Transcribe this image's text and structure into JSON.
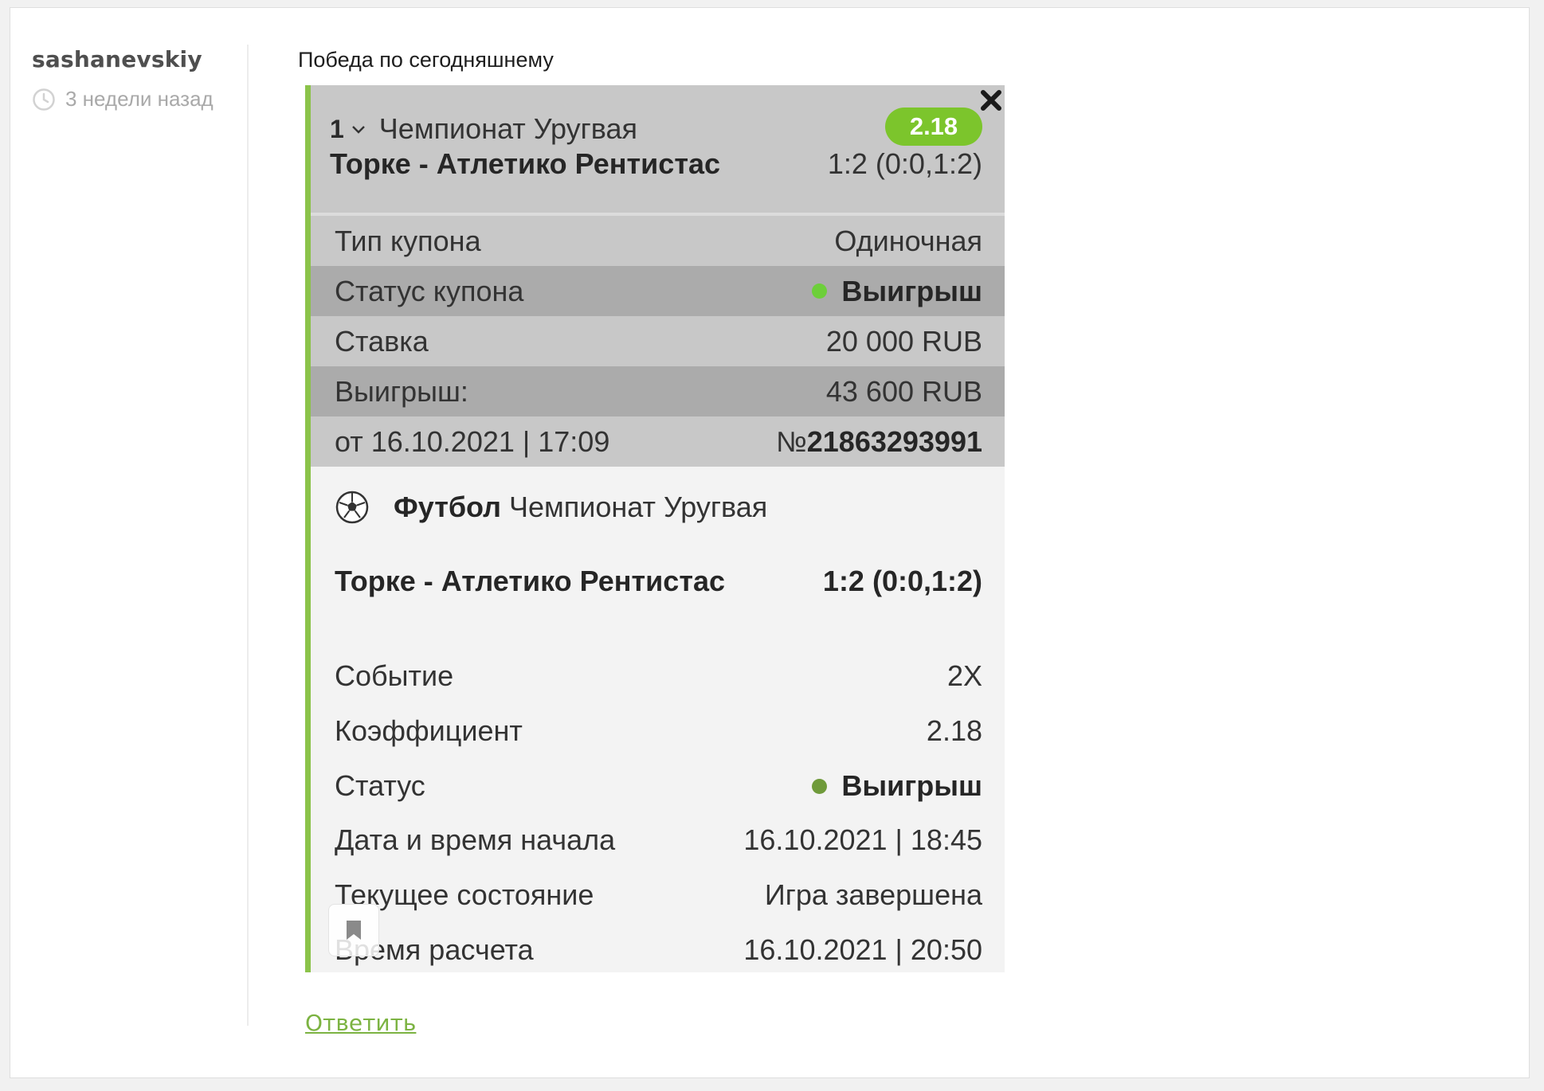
{
  "comment": {
    "author": "sashanevskiy",
    "time": "3 недели назад",
    "text": "Победа по сегодняшнему",
    "reply_label": "Ответить"
  },
  "coupon": {
    "header": {
      "index": "1",
      "league": "Чемпионат Уругвая",
      "odds": "2.18",
      "match": "Торке - Атлетико Рентистас",
      "score": "1:2 (0:0,1:2)"
    },
    "summary": [
      {
        "label": "Тип купона",
        "value": "Одиночная"
      },
      {
        "label": "Статус купона",
        "value": "Выигрыш"
      },
      {
        "label": "Ставка",
        "value": "20 000 RUB"
      },
      {
        "label": "Выигрыш:",
        "value": "43 600 RUB"
      },
      {
        "label": "от 16.10.2021 | 17:09",
        "value_prefix": "№",
        "value": "21863293991"
      }
    ],
    "event": {
      "sport": "Футбол",
      "league": "Чемпионат Уругвая",
      "match": "Торке - Атлетико Рентистас",
      "score": "1:2 (0:0,1:2)"
    },
    "details": [
      {
        "label": "Событие",
        "value": "2X"
      },
      {
        "label": "Коэффициент",
        "value": "2.18"
      },
      {
        "label": "Статус",
        "value": "Выигрыш"
      },
      {
        "label": "Дата и время начала",
        "value": "16.10.2021 | 18:45"
      },
      {
        "label": "Текущее состояние",
        "value": "Игра завершена"
      },
      {
        "label": "Время расчета",
        "value": "16.10.2021 | 20:50"
      }
    ],
    "colors": {
      "accent_green": "#8bc34a",
      "badge_green": "#7cc52c",
      "status_dot": "#6dcf3a"
    }
  }
}
